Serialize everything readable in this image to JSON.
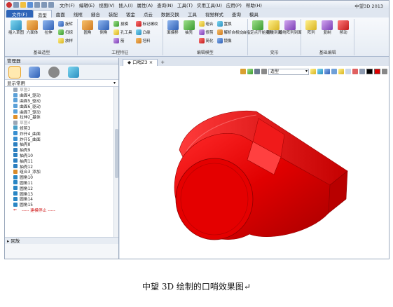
{
  "window": {
    "title": "中望3D 2013",
    "menu": [
      "文件(F)",
      "编辑(E)",
      "视图(V)",
      "插入(I)",
      "属性(A)",
      "查询(N)",
      "工具(T)",
      "实用工具(U)",
      "应用(P)",
      "帮助(H)"
    ]
  },
  "ribbon_tabs": [
    "文件(F)",
    "造型",
    "曲面",
    "线框",
    "缝合",
    "装配",
    "钣金",
    "点云",
    "数据交换",
    "工具",
    "视觉样式",
    "查询",
    "模具"
  ],
  "ribbon_groups": [
    {
      "label": "基础造型",
      "big": [
        {
          "label": "插入草图",
          "icon": "sketch-icon"
        },
        {
          "label": "六面体",
          "icon": "block-icon"
        },
        {
          "label": "拉伸",
          "icon": "extrude-icon"
        }
      ],
      "small": [
        {
          "label": "旋转",
          "icon": "revolve-icon"
        },
        {
          "label": "扫掠",
          "icon": "sweep-icon"
        },
        {
          "label": "放样",
          "icon": "loft-icon"
        }
      ]
    },
    {
      "label": "工程特征",
      "big": [
        {
          "label": "圆角",
          "icon": "fillet-icon"
        },
        {
          "label": "倒角",
          "icon": "chamfer-icon"
        }
      ],
      "small": [
        {
          "label": "拔模",
          "icon": "draft-icon"
        },
        {
          "label": "孔工具",
          "icon": "hole-icon"
        },
        {
          "label": "筋",
          "icon": "rib-icon"
        },
        {
          "label": "标记螺纹",
          "icon": "thread-icon"
        },
        {
          "label": "凸缘",
          "icon": "lip-icon"
        },
        {
          "label": "坯料",
          "icon": "stock-icon"
        }
      ]
    },
    {
      "label": "编辑模型",
      "big": [
        {
          "label": "面偏移",
          "icon": "face-offset-icon"
        },
        {
          "label": "抽壳",
          "icon": "shell-icon"
        }
      ],
      "small": [
        {
          "label": "组合",
          "icon": "combine-icon"
        },
        {
          "label": "修剪",
          "icon": "trim-icon"
        },
        {
          "label": "简化",
          "icon": "simplify-icon"
        },
        {
          "label": "置换",
          "icon": "replace-icon"
        },
        {
          "label": "解析自相交",
          "icon": "self-intersect-icon"
        },
        {
          "label": "镜像",
          "icon": "mirror-icon"
        }
      ]
    },
    {
      "label": "变形",
      "big": [
        {
          "label": "由指定点开始变形",
          "icon": "morph-icon"
        },
        {
          "label": "缠绕到面",
          "icon": "wrap-icon"
        },
        {
          "label": "缠绕阵列到面",
          "icon": "wrap-pattern-icon"
        }
      ]
    },
    {
      "label": "基础编辑",
      "big": [
        {
          "label": "阵列",
          "icon": "pattern-icon"
        },
        {
          "label": "复制",
          "icon": "copy-icon"
        },
        {
          "label": "移动",
          "icon": "move-icon"
        }
      ]
    }
  ],
  "manager": {
    "title": "管理器",
    "display_mode": "显示常用",
    "tree": [
      {
        "label": "草图2",
        "icon": "sketch-icon",
        "state": "gray"
      },
      {
        "label": "曲面4_驱动",
        "icon": "surface-icon",
        "state": "normal"
      },
      {
        "label": "曲面5_驱动",
        "icon": "surface-icon",
        "state": "normal"
      },
      {
        "label": "曲面6_驱动",
        "icon": "surface-icon",
        "state": "normal"
      },
      {
        "label": "曲面7_驱动",
        "icon": "surface-icon",
        "state": "normal"
      },
      {
        "label": "拉伸2_基体",
        "icon": "extrude-icon",
        "state": "normal"
      },
      {
        "label": "草图4",
        "icon": "sketch-icon",
        "state": "gray"
      },
      {
        "label": "修剪3",
        "icon": "trim-icon",
        "state": "normal"
      },
      {
        "label": "炸开4_曲面",
        "icon": "explode-icon",
        "state": "normal"
      },
      {
        "label": "炸开5_曲面",
        "icon": "explode-icon",
        "state": "normal"
      },
      {
        "label": "抽壳8",
        "icon": "shell-icon",
        "state": "normal"
      },
      {
        "label": "抽壳9",
        "icon": "shell-icon",
        "state": "normal"
      },
      {
        "label": "抽壳10",
        "icon": "shell-icon",
        "state": "normal"
      },
      {
        "label": "抽壳11",
        "icon": "shell-icon",
        "state": "normal"
      },
      {
        "label": "抽壳12",
        "icon": "shell-icon",
        "state": "normal"
      },
      {
        "label": "组合3_添加",
        "icon": "combine-icon",
        "state": "normal"
      },
      {
        "label": "圆角10",
        "icon": "fillet-icon",
        "state": "normal"
      },
      {
        "label": "圆角11",
        "icon": "fillet-icon",
        "state": "normal"
      },
      {
        "label": "圆角12",
        "icon": "fillet-icon",
        "state": "normal"
      },
      {
        "label": "圆角13",
        "icon": "fillet-icon",
        "state": "normal"
      },
      {
        "label": "圆角14",
        "icon": "fillet-icon",
        "state": "normal"
      },
      {
        "label": "圆角15",
        "icon": "fillet-icon",
        "state": "normal"
      },
      {
        "label": "----- 建模停止 -----",
        "icon": "arrow-left-icon",
        "state": "rollback"
      }
    ],
    "rollback_label": "▸ 回放"
  },
  "document_tab": {
    "label": "口哨Z3",
    "close": "×",
    "add": "+"
  },
  "view_toolbar": {
    "filter_value": "造型"
  },
  "model": {
    "color": "#e00000",
    "name": "口哨"
  },
  "caption": "中望 3D 绘制的口哨效果图↵"
}
